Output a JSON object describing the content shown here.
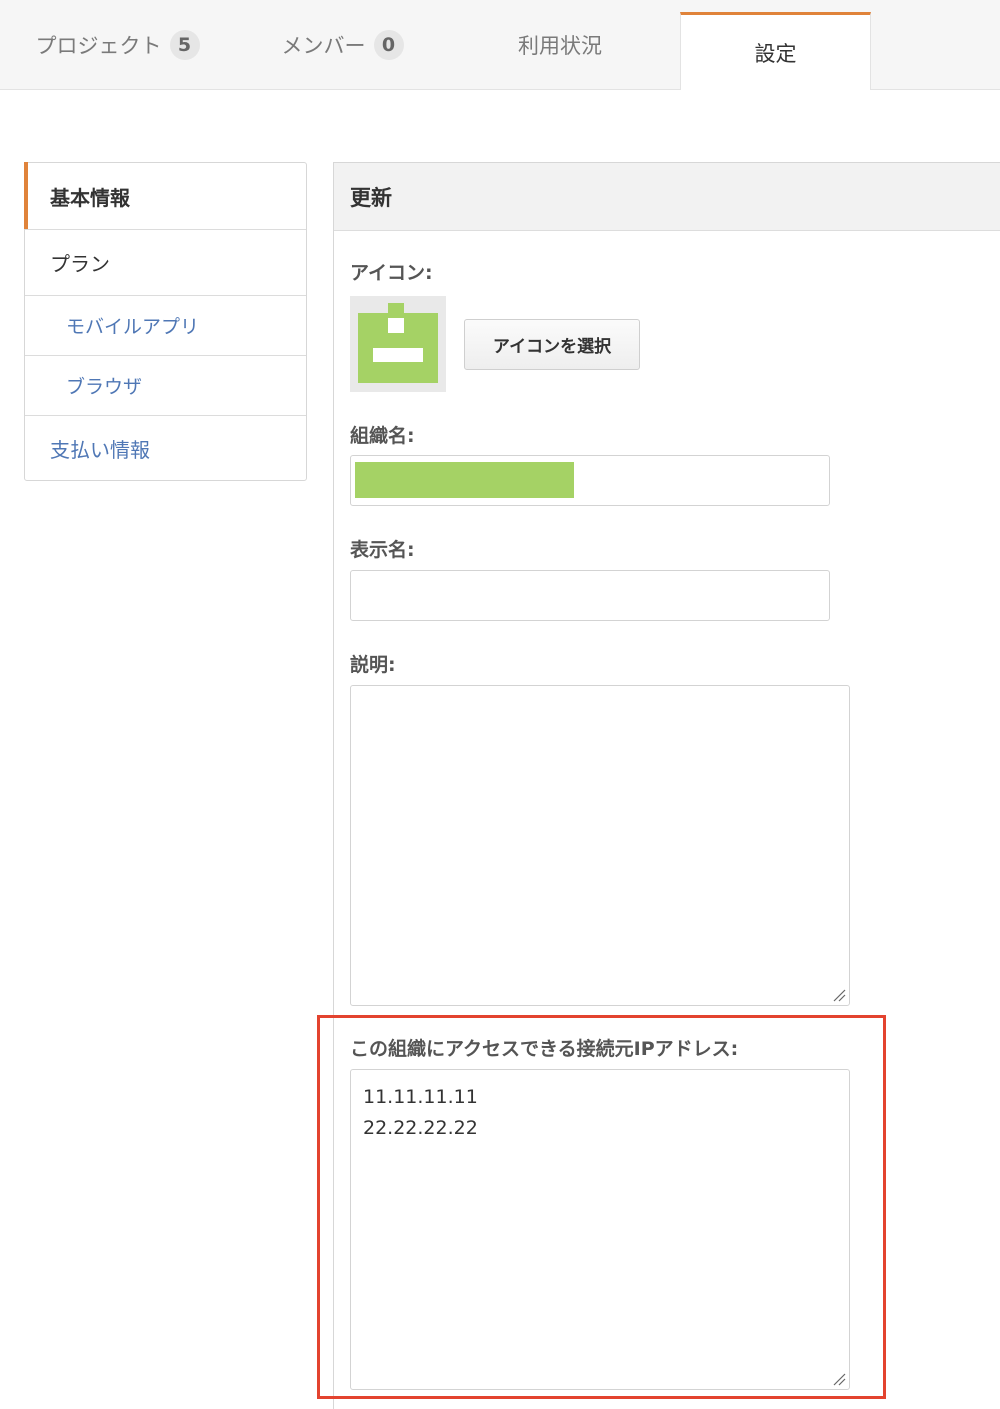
{
  "tabs": [
    {
      "label": "プロジェクト",
      "badge": "5"
    },
    {
      "label": "メンバー",
      "badge": "0"
    },
    {
      "label": "利用状況"
    },
    {
      "label": "設定"
    }
  ],
  "sidemenu": {
    "items": [
      {
        "label": "基本情報"
      },
      {
        "label": "プラン"
      },
      {
        "label": "モバイルアプリ"
      },
      {
        "label": "ブラウザ"
      },
      {
        "label": "支払い情報"
      }
    ]
  },
  "panel": {
    "title": "更新",
    "icon_label": "アイコン:",
    "select_icon_button": "アイコンを選択",
    "org_name_label": "組織名:",
    "display_name_label": "表示名:",
    "description_label": "説明:",
    "ip_label": "この組織にアクセスできる接続元IPアドレス:",
    "ip_addresses": [
      "11.11.11.11",
      "22.22.22.22"
    ]
  },
  "colors": {
    "accent": "#e0833a",
    "link": "#4f77b5",
    "icon_green": "#a5d265",
    "highlight": "#e3432f"
  },
  "icons": {
    "org_icon": "pixel-inbox-icon",
    "resize": "resize-grip-icon"
  }
}
